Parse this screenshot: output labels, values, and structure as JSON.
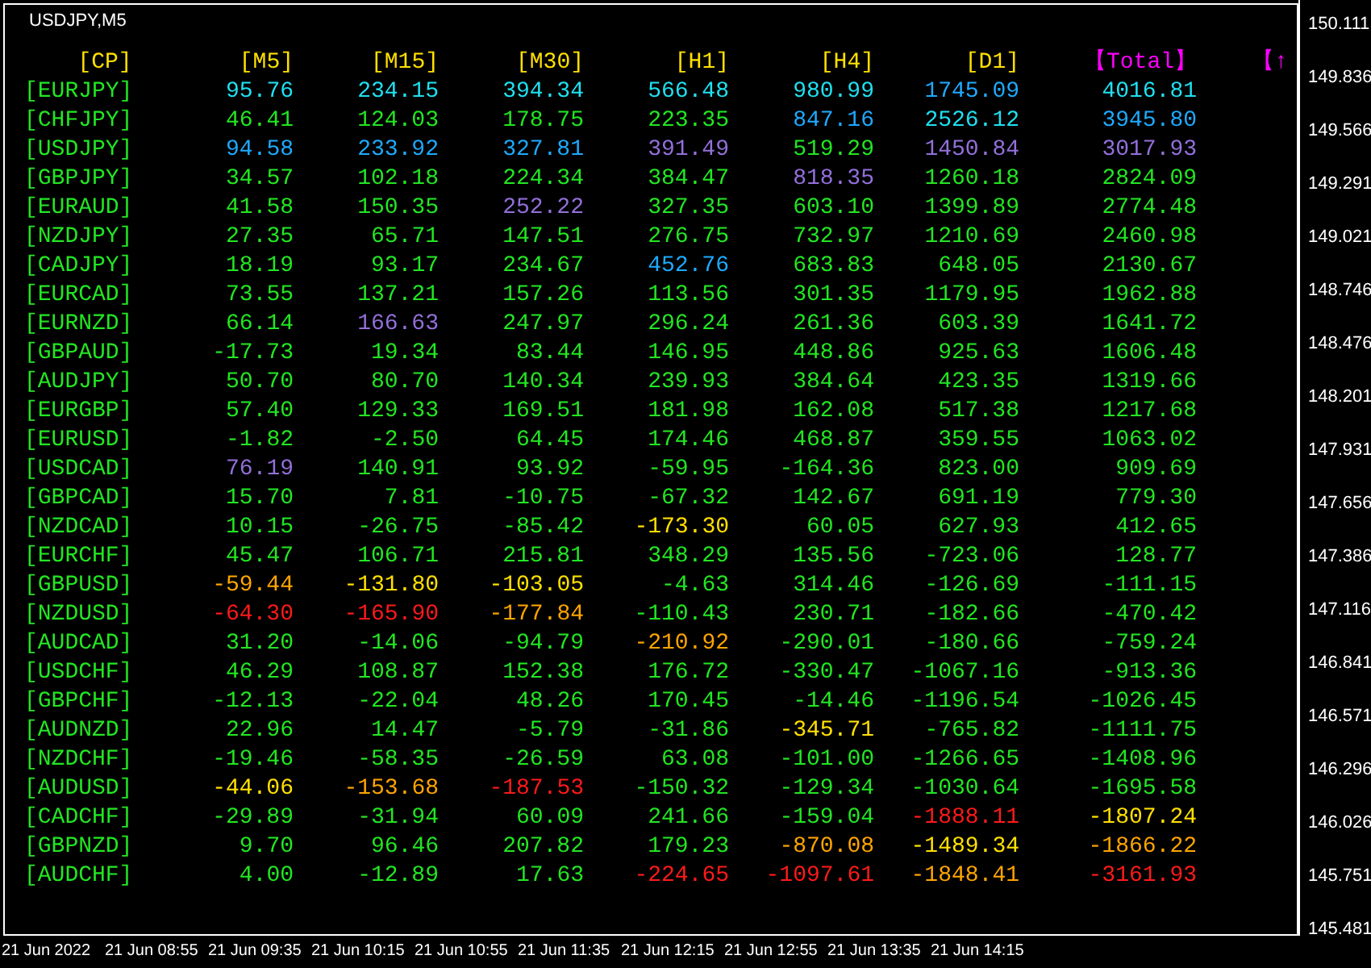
{
  "chart": {
    "title": "USDJPY,M5"
  },
  "table": {
    "columns": [
      {
        "label": "[CP]",
        "color": "#ffe000"
      },
      {
        "label": "[M5]",
        "color": "#ffe000"
      },
      {
        "label": "[M15]",
        "color": "#ffe000"
      },
      {
        "label": "[M30]",
        "color": "#ffe000"
      },
      {
        "label": "[H1]",
        "color": "#ffe000"
      },
      {
        "label": "[H4]",
        "color": "#ffe000"
      },
      {
        "label": "[D1]",
        "color": "#ffe000"
      },
      {
        "label": "【Total】",
        "color": "#ff00ff"
      },
      {
        "label": "【↑",
        "color": "#ff00ff"
      }
    ],
    "rows": [
      {
        "cells": [
          {
            "value": "[EURJPY]",
            "color": "#22e622"
          },
          {
            "value": "95.76",
            "color": "#20e0f0"
          },
          {
            "value": "234.15",
            "color": "#20e0f0"
          },
          {
            "value": "394.34",
            "color": "#20e0f0"
          },
          {
            "value": "566.48",
            "color": "#20e0f0"
          },
          {
            "value": "980.99",
            "color": "#20e0f0"
          },
          {
            "value": "1745.09",
            "color": "#1eaaff"
          },
          {
            "value": "4016.81",
            "color": "#20e0f0"
          }
        ]
      },
      {
        "cells": [
          {
            "value": "[CHFJPY]",
            "color": "#22e622"
          },
          {
            "value": "46.41",
            "color": "#22e622"
          },
          {
            "value": "124.03",
            "color": "#22e622"
          },
          {
            "value": "178.75",
            "color": "#22e622"
          },
          {
            "value": "223.35",
            "color": "#22e622"
          },
          {
            "value": "847.16",
            "color": "#1eaaff"
          },
          {
            "value": "2526.12",
            "color": "#20e0f0"
          },
          {
            "value": "3945.80",
            "color": "#1eaaff"
          }
        ]
      },
      {
        "cells": [
          {
            "value": "[USDJPY]",
            "color": "#22e622"
          },
          {
            "value": "94.58",
            "color": "#1eaaff"
          },
          {
            "value": "233.92",
            "color": "#1eaaff"
          },
          {
            "value": "327.81",
            "color": "#1eaaff"
          },
          {
            "value": "391.49",
            "color": "#9370db"
          },
          {
            "value": "519.29",
            "color": "#22e622"
          },
          {
            "value": "1450.84",
            "color": "#9370db"
          },
          {
            "value": "3017.93",
            "color": "#9370db"
          }
        ]
      },
      {
        "cells": [
          {
            "value": "[GBPJPY]",
            "color": "#22e622"
          },
          {
            "value": "34.57",
            "color": "#22e622"
          },
          {
            "value": "102.18",
            "color": "#22e622"
          },
          {
            "value": "224.34",
            "color": "#22e622"
          },
          {
            "value": "384.47",
            "color": "#22e622"
          },
          {
            "value": "818.35",
            "color": "#9370db"
          },
          {
            "value": "1260.18",
            "color": "#22e622"
          },
          {
            "value": "2824.09",
            "color": "#22e622"
          }
        ]
      },
      {
        "cells": [
          {
            "value": "[EURAUD]",
            "color": "#22e622"
          },
          {
            "value": "41.58",
            "color": "#22e622"
          },
          {
            "value": "150.35",
            "color": "#22e622"
          },
          {
            "value": "252.22",
            "color": "#9370db"
          },
          {
            "value": "327.35",
            "color": "#22e622"
          },
          {
            "value": "603.10",
            "color": "#22e622"
          },
          {
            "value": "1399.89",
            "color": "#22e622"
          },
          {
            "value": "2774.48",
            "color": "#22e622"
          }
        ]
      },
      {
        "cells": [
          {
            "value": "[NZDJPY]",
            "color": "#22e622"
          },
          {
            "value": "27.35",
            "color": "#22e622"
          },
          {
            "value": "65.71",
            "color": "#22e622"
          },
          {
            "value": "147.51",
            "color": "#22e622"
          },
          {
            "value": "276.75",
            "color": "#22e622"
          },
          {
            "value": "732.97",
            "color": "#22e622"
          },
          {
            "value": "1210.69",
            "color": "#22e622"
          },
          {
            "value": "2460.98",
            "color": "#22e622"
          }
        ]
      },
      {
        "cells": [
          {
            "value": "[CADJPY]",
            "color": "#22e622"
          },
          {
            "value": "18.19",
            "color": "#22e622"
          },
          {
            "value": "93.17",
            "color": "#22e622"
          },
          {
            "value": "234.67",
            "color": "#22e622"
          },
          {
            "value": "452.76",
            "color": "#1eaaff"
          },
          {
            "value": "683.83",
            "color": "#22e622"
          },
          {
            "value": "648.05",
            "color": "#22e622"
          },
          {
            "value": "2130.67",
            "color": "#22e622"
          }
        ]
      },
      {
        "cells": [
          {
            "value": "[EURCAD]",
            "color": "#22e622"
          },
          {
            "value": "73.55",
            "color": "#22e622"
          },
          {
            "value": "137.21",
            "color": "#22e622"
          },
          {
            "value": "157.26",
            "color": "#22e622"
          },
          {
            "value": "113.56",
            "color": "#22e622"
          },
          {
            "value": "301.35",
            "color": "#22e622"
          },
          {
            "value": "1179.95",
            "color": "#22e622"
          },
          {
            "value": "1962.88",
            "color": "#22e622"
          }
        ]
      },
      {
        "cells": [
          {
            "value": "[EURNZD]",
            "color": "#22e622"
          },
          {
            "value": "66.14",
            "color": "#22e622"
          },
          {
            "value": "166.63",
            "color": "#9370db"
          },
          {
            "value": "247.97",
            "color": "#22e622"
          },
          {
            "value": "296.24",
            "color": "#22e622"
          },
          {
            "value": "261.36",
            "color": "#22e622"
          },
          {
            "value": "603.39",
            "color": "#22e622"
          },
          {
            "value": "1641.72",
            "color": "#22e622"
          }
        ]
      },
      {
        "cells": [
          {
            "value": "[GBPAUD]",
            "color": "#22e622"
          },
          {
            "value": "-17.73",
            "color": "#22e622"
          },
          {
            "value": "19.34",
            "color": "#22e622"
          },
          {
            "value": "83.44",
            "color": "#22e622"
          },
          {
            "value": "146.95",
            "color": "#22e622"
          },
          {
            "value": "448.86",
            "color": "#22e622"
          },
          {
            "value": "925.63",
            "color": "#22e622"
          },
          {
            "value": "1606.48",
            "color": "#22e622"
          }
        ]
      },
      {
        "cells": [
          {
            "value": "[AUDJPY]",
            "color": "#22e622"
          },
          {
            "value": "50.70",
            "color": "#22e622"
          },
          {
            "value": "80.70",
            "color": "#22e622"
          },
          {
            "value": "140.34",
            "color": "#22e622"
          },
          {
            "value": "239.93",
            "color": "#22e622"
          },
          {
            "value": "384.64",
            "color": "#22e622"
          },
          {
            "value": "423.35",
            "color": "#22e622"
          },
          {
            "value": "1319.66",
            "color": "#22e622"
          }
        ]
      },
      {
        "cells": [
          {
            "value": "[EURGBP]",
            "color": "#22e622"
          },
          {
            "value": "57.40",
            "color": "#22e622"
          },
          {
            "value": "129.33",
            "color": "#22e622"
          },
          {
            "value": "169.51",
            "color": "#22e622"
          },
          {
            "value": "181.98",
            "color": "#22e622"
          },
          {
            "value": "162.08",
            "color": "#22e622"
          },
          {
            "value": "517.38",
            "color": "#22e622"
          },
          {
            "value": "1217.68",
            "color": "#22e622"
          }
        ]
      },
      {
        "cells": [
          {
            "value": "[EURUSD]",
            "color": "#22e622"
          },
          {
            "value": "-1.82",
            "color": "#22e622"
          },
          {
            "value": "-2.50",
            "color": "#22e622"
          },
          {
            "value": "64.45",
            "color": "#22e622"
          },
          {
            "value": "174.46",
            "color": "#22e622"
          },
          {
            "value": "468.87",
            "color": "#22e622"
          },
          {
            "value": "359.55",
            "color": "#22e622"
          },
          {
            "value": "1063.02",
            "color": "#22e622"
          }
        ]
      },
      {
        "cells": [
          {
            "value": "[USDCAD]",
            "color": "#22e622"
          },
          {
            "value": "76.19",
            "color": "#9370db"
          },
          {
            "value": "140.91",
            "color": "#22e622"
          },
          {
            "value": "93.92",
            "color": "#22e622"
          },
          {
            "value": "-59.95",
            "color": "#22e622"
          },
          {
            "value": "-164.36",
            "color": "#22e622"
          },
          {
            "value": "823.00",
            "color": "#22e622"
          },
          {
            "value": "909.69",
            "color": "#22e622"
          }
        ]
      },
      {
        "cells": [
          {
            "value": "[GBPCAD]",
            "color": "#22e622"
          },
          {
            "value": "15.70",
            "color": "#22e622"
          },
          {
            "value": "7.81",
            "color": "#22e622"
          },
          {
            "value": "-10.75",
            "color": "#22e622"
          },
          {
            "value": "-67.32",
            "color": "#22e622"
          },
          {
            "value": "142.67",
            "color": "#22e622"
          },
          {
            "value": "691.19",
            "color": "#22e622"
          },
          {
            "value": "779.30",
            "color": "#22e622"
          }
        ]
      },
      {
        "cells": [
          {
            "value": "[NZDCAD]",
            "color": "#22e622"
          },
          {
            "value": "10.15",
            "color": "#22e622"
          },
          {
            "value": "-26.75",
            "color": "#22e622"
          },
          {
            "value": "-85.42",
            "color": "#22e622"
          },
          {
            "value": "-173.30",
            "color": "#ffe000"
          },
          {
            "value": "60.05",
            "color": "#22e622"
          },
          {
            "value": "627.93",
            "color": "#22e622"
          },
          {
            "value": "412.65",
            "color": "#22e622"
          }
        ]
      },
      {
        "cells": [
          {
            "value": "[EURCHF]",
            "color": "#22e622"
          },
          {
            "value": "45.47",
            "color": "#22e622"
          },
          {
            "value": "106.71",
            "color": "#22e622"
          },
          {
            "value": "215.81",
            "color": "#22e622"
          },
          {
            "value": "348.29",
            "color": "#22e622"
          },
          {
            "value": "135.56",
            "color": "#22e622"
          },
          {
            "value": "-723.06",
            "color": "#22e622"
          },
          {
            "value": "128.77",
            "color": "#22e622"
          }
        ]
      },
      {
        "cells": [
          {
            "value": "[GBPUSD]",
            "color": "#22e622"
          },
          {
            "value": "-59.44",
            "color": "#ffa500"
          },
          {
            "value": "-131.80",
            "color": "#ffe000"
          },
          {
            "value": "-103.05",
            "color": "#ffe000"
          },
          {
            "value": "-4.63",
            "color": "#22e622"
          },
          {
            "value": "314.46",
            "color": "#22e622"
          },
          {
            "value": "-126.69",
            "color": "#22e622"
          },
          {
            "value": "-111.15",
            "color": "#22e622"
          }
        ]
      },
      {
        "cells": [
          {
            "value": "[NZDUSD]",
            "color": "#22e622"
          },
          {
            "value": "-64.30",
            "color": "#ff1a1a"
          },
          {
            "value": "-165.90",
            "color": "#ff1a1a"
          },
          {
            "value": "-177.84",
            "color": "#ffa500"
          },
          {
            "value": "-110.43",
            "color": "#22e622"
          },
          {
            "value": "230.71",
            "color": "#22e622"
          },
          {
            "value": "-182.66",
            "color": "#22e622"
          },
          {
            "value": "-470.42",
            "color": "#22e622"
          }
        ]
      },
      {
        "cells": [
          {
            "value": "[AUDCAD]",
            "color": "#22e622"
          },
          {
            "value": "31.20",
            "color": "#22e622"
          },
          {
            "value": "-14.06",
            "color": "#22e622"
          },
          {
            "value": "-94.79",
            "color": "#22e622"
          },
          {
            "value": "-210.92",
            "color": "#ffa500"
          },
          {
            "value": "-290.01",
            "color": "#22e622"
          },
          {
            "value": "-180.66",
            "color": "#22e622"
          },
          {
            "value": "-759.24",
            "color": "#22e622"
          }
        ]
      },
      {
        "cells": [
          {
            "value": "[USDCHF]",
            "color": "#22e622"
          },
          {
            "value": "46.29",
            "color": "#22e622"
          },
          {
            "value": "108.87",
            "color": "#22e622"
          },
          {
            "value": "152.38",
            "color": "#22e622"
          },
          {
            "value": "176.72",
            "color": "#22e622"
          },
          {
            "value": "-330.47",
            "color": "#22e622"
          },
          {
            "value": "-1067.16",
            "color": "#22e622"
          },
          {
            "value": "-913.36",
            "color": "#22e622"
          }
        ]
      },
      {
        "cells": [
          {
            "value": "[GBPCHF]",
            "color": "#22e622"
          },
          {
            "value": "-12.13",
            "color": "#22e622"
          },
          {
            "value": "-22.04",
            "color": "#22e622"
          },
          {
            "value": "48.26",
            "color": "#22e622"
          },
          {
            "value": "170.45",
            "color": "#22e622"
          },
          {
            "value": "-14.46",
            "color": "#22e622"
          },
          {
            "value": "-1196.54",
            "color": "#22e622"
          },
          {
            "value": "-1026.45",
            "color": "#22e622"
          }
        ]
      },
      {
        "cells": [
          {
            "value": "[AUDNZD]",
            "color": "#22e622"
          },
          {
            "value": "22.96",
            "color": "#22e622"
          },
          {
            "value": "14.47",
            "color": "#22e622"
          },
          {
            "value": "-5.79",
            "color": "#22e622"
          },
          {
            "value": "-31.86",
            "color": "#22e622"
          },
          {
            "value": "-345.71",
            "color": "#ffe000"
          },
          {
            "value": "-765.82",
            "color": "#22e622"
          },
          {
            "value": "-1111.75",
            "color": "#22e622"
          }
        ]
      },
      {
        "cells": [
          {
            "value": "[NZDCHF]",
            "color": "#22e622"
          },
          {
            "value": "-19.46",
            "color": "#22e622"
          },
          {
            "value": "-58.35",
            "color": "#22e622"
          },
          {
            "value": "-26.59",
            "color": "#22e622"
          },
          {
            "value": "63.08",
            "color": "#22e622"
          },
          {
            "value": "-101.00",
            "color": "#22e622"
          },
          {
            "value": "-1266.65",
            "color": "#22e622"
          },
          {
            "value": "-1408.96",
            "color": "#22e622"
          }
        ]
      },
      {
        "cells": [
          {
            "value": "[AUDUSD]",
            "color": "#22e622"
          },
          {
            "value": "-44.06",
            "color": "#ffe000"
          },
          {
            "value": "-153.68",
            "color": "#ffa500"
          },
          {
            "value": "-187.53",
            "color": "#ff1a1a"
          },
          {
            "value": "-150.32",
            "color": "#22e622"
          },
          {
            "value": "-129.34",
            "color": "#22e622"
          },
          {
            "value": "-1030.64",
            "color": "#22e622"
          },
          {
            "value": "-1695.58",
            "color": "#22e622"
          }
        ]
      },
      {
        "cells": [
          {
            "value": "[CADCHF]",
            "color": "#22e622"
          },
          {
            "value": "-29.89",
            "color": "#22e622"
          },
          {
            "value": "-31.94",
            "color": "#22e622"
          },
          {
            "value": "60.09",
            "color": "#22e622"
          },
          {
            "value": "241.66",
            "color": "#22e622"
          },
          {
            "value": "-159.04",
            "color": "#22e622"
          },
          {
            "value": "-1888.11",
            "color": "#ff1a1a"
          },
          {
            "value": "-1807.24",
            "color": "#ffe000"
          }
        ]
      },
      {
        "cells": [
          {
            "value": "[GBPNZD]",
            "color": "#22e622"
          },
          {
            "value": "9.70",
            "color": "#22e622"
          },
          {
            "value": "96.46",
            "color": "#22e622"
          },
          {
            "value": "207.82",
            "color": "#22e622"
          },
          {
            "value": "179.23",
            "color": "#22e622"
          },
          {
            "value": "-870.08",
            "color": "#ffa500"
          },
          {
            "value": "-1489.34",
            "color": "#ffe000"
          },
          {
            "value": "-1866.22",
            "color": "#ffa500"
          }
        ]
      },
      {
        "cells": [
          {
            "value": "[AUDCHF]",
            "color": "#22e622"
          },
          {
            "value": "4.00",
            "color": "#22e622"
          },
          {
            "value": "-12.89",
            "color": "#22e622"
          },
          {
            "value": "17.63",
            "color": "#22e622"
          },
          {
            "value": "-224.65",
            "color": "#ff1a1a"
          },
          {
            "value": "-1097.61",
            "color": "#ff1a1a"
          },
          {
            "value": "-1848.41",
            "color": "#ffa500"
          },
          {
            "value": "-3161.93",
            "color": "#ff1a1a"
          }
        ]
      }
    ]
  },
  "price_axis": [
    "150.111",
    "149.836",
    "149.566",
    "149.291",
    "149.021",
    "148.746",
    "148.476",
    "148.201",
    "147.931",
    "147.656",
    "147.386",
    "147.116",
    "146.841",
    "146.571",
    "146.296",
    "146.026",
    "145.751",
    "145.481"
  ],
  "time_axis": [
    "21 Jun 2022",
    "21 Jun 08:55",
    "21 Jun 09:35",
    "21 Jun 10:15",
    "21 Jun 10:55",
    "21 Jun 11:35",
    "21 Jun 12:15",
    "21 Jun 12:55",
    "21 Jun 13:35",
    "21 Jun 14:15"
  ]
}
